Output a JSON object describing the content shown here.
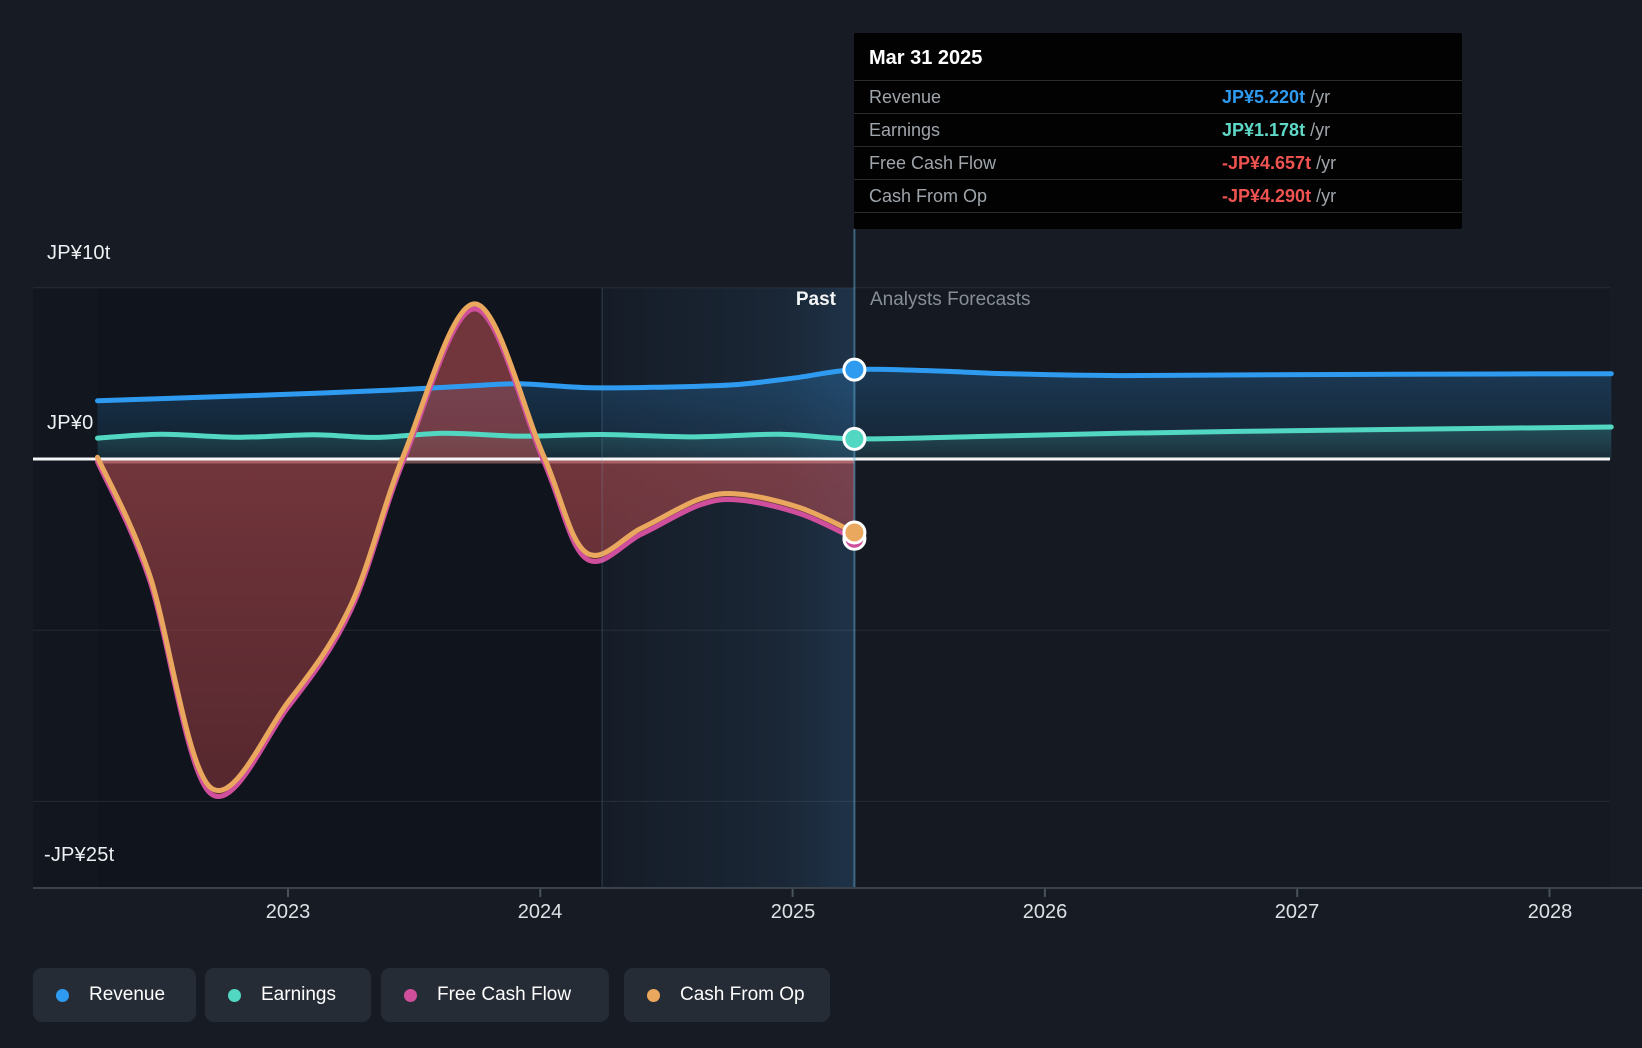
{
  "captions": {
    "past": "Past",
    "forecast": "Analysts Forecasts"
  },
  "y_axis": {
    "top": "JP¥10t",
    "zero": "JP¥0",
    "bottom": "-JP¥25t"
  },
  "x_axis": {
    "years": [
      "2023",
      "2024",
      "2025",
      "2026",
      "2027",
      "2028"
    ]
  },
  "tooltip": {
    "date": "Mar 31 2025",
    "rows": [
      {
        "label": "Revenue",
        "value": "JP¥5.220t",
        "suffix": "/yr",
        "color": "#2e9bf0"
      },
      {
        "label": "Earnings",
        "value": "JP¥1.178t",
        "suffix": "/yr",
        "color": "#5fd8c7"
      },
      {
        "label": "Free Cash Flow",
        "value": "-JP¥4.657t",
        "suffix": "/yr",
        "color": "#ef5350"
      },
      {
        "label": "Cash From Op",
        "value": "-JP¥4.290t",
        "suffix": "/yr",
        "color": "#ef5350"
      }
    ]
  },
  "legend": [
    {
      "label": "Revenue",
      "color": "#2e9bf0"
    },
    {
      "label": "Earnings",
      "color": "#52d7c3"
    },
    {
      "label": "Free Cash Flow",
      "color": "#cf4f9c"
    },
    {
      "label": "Cash From Op",
      "color": "#e9a85e"
    }
  ],
  "colors": {
    "background": "#161b24",
    "plot_background": "#12171f",
    "band_highlight_end": "#1f3349",
    "zero_line": "#f5f6f7",
    "negative_value": "#ef5350",
    "tooltip_background": "#020202"
  },
  "chart_data": {
    "type": "line",
    "unit": "JP¥ trillions per year",
    "ylim": [
      -25,
      10
    ],
    "xlim": [
      2021.99,
      2028.25
    ],
    "grid_values": [
      10,
      0,
      -10,
      -20,
      -25
    ],
    "x_ticks": [
      2023,
      2024,
      2025,
      2026,
      2027,
      2028
    ],
    "data_start": 2022.245,
    "divider": 2025.245,
    "highlight_band": [
      2024.245,
      2025.245
    ],
    "legend_position": "bottom",
    "series": [
      {
        "name": "Revenue",
        "color": "#2e9bf0",
        "area": "to_zero",
        "forecast": true,
        "dot_value": 5.22,
        "points": [
          [
            2022.245,
            3.4
          ],
          [
            2022.6,
            3.58
          ],
          [
            2023.0,
            3.78
          ],
          [
            2023.4,
            4.02
          ],
          [
            2023.76,
            4.3
          ],
          [
            2023.92,
            4.39
          ],
          [
            2024.18,
            4.17
          ],
          [
            2024.45,
            4.19
          ],
          [
            2024.76,
            4.33
          ],
          [
            2025.0,
            4.72
          ],
          [
            2025.245,
            5.22
          ],
          [
            2025.55,
            5.15
          ],
          [
            2025.85,
            4.98
          ],
          [
            2026.3,
            4.87
          ],
          [
            2026.9,
            4.92
          ],
          [
            2027.6,
            4.96
          ],
          [
            2028.245,
            4.98
          ]
        ]
      },
      {
        "name": "Earnings",
        "color": "#52d7c3",
        "area": "to_zero",
        "forecast": true,
        "dot_value": 1.178,
        "points": [
          [
            2022.245,
            1.22
          ],
          [
            2022.5,
            1.44
          ],
          [
            2022.8,
            1.27
          ],
          [
            2023.1,
            1.42
          ],
          [
            2023.35,
            1.26
          ],
          [
            2023.62,
            1.5
          ],
          [
            2023.92,
            1.34
          ],
          [
            2024.245,
            1.43
          ],
          [
            2024.6,
            1.29
          ],
          [
            2024.95,
            1.44
          ],
          [
            2025.245,
            1.178
          ],
          [
            2025.7,
            1.3
          ],
          [
            2026.3,
            1.5
          ],
          [
            2027.0,
            1.66
          ],
          [
            2027.7,
            1.78
          ],
          [
            2028.245,
            1.87
          ]
        ]
      },
      {
        "name": "Free Cash Flow",
        "color": "#cf4f9c",
        "area": "to_zero_red",
        "forecast": false,
        "dot_value": -4.657,
        "points": [
          [
            2022.245,
            -0.15
          ],
          [
            2022.45,
            -7.0
          ],
          [
            2022.69,
            -19.5
          ],
          [
            2023.0,
            -14.5
          ],
          [
            2023.25,
            -8.8
          ],
          [
            2023.46,
            0.0
          ],
          [
            2023.74,
            8.77
          ],
          [
            2024.01,
            0.0
          ],
          [
            2024.18,
            -5.8
          ],
          [
            2024.4,
            -4.4
          ],
          [
            2024.63,
            -2.7
          ],
          [
            2024.79,
            -2.4
          ],
          [
            2025.03,
            -3.2
          ],
          [
            2025.245,
            -4.657
          ]
        ]
      },
      {
        "name": "Cash From Op",
        "color": "#e9a85e",
        "area": null,
        "forecast": false,
        "dot_value": -4.29,
        "points": [
          [
            2022.245,
            0.1
          ],
          [
            2022.45,
            -6.7
          ],
          [
            2022.69,
            -19.15
          ],
          [
            2023.0,
            -14.2
          ],
          [
            2023.25,
            -8.5
          ],
          [
            2023.46,
            0.3
          ],
          [
            2023.74,
            9.06
          ],
          [
            2024.01,
            0.3
          ],
          [
            2024.18,
            -5.45
          ],
          [
            2024.4,
            -4.05
          ],
          [
            2024.63,
            -2.35
          ],
          [
            2024.79,
            -2.05
          ],
          [
            2025.03,
            -2.85
          ],
          [
            2025.245,
            -4.29
          ]
        ]
      }
    ]
  }
}
